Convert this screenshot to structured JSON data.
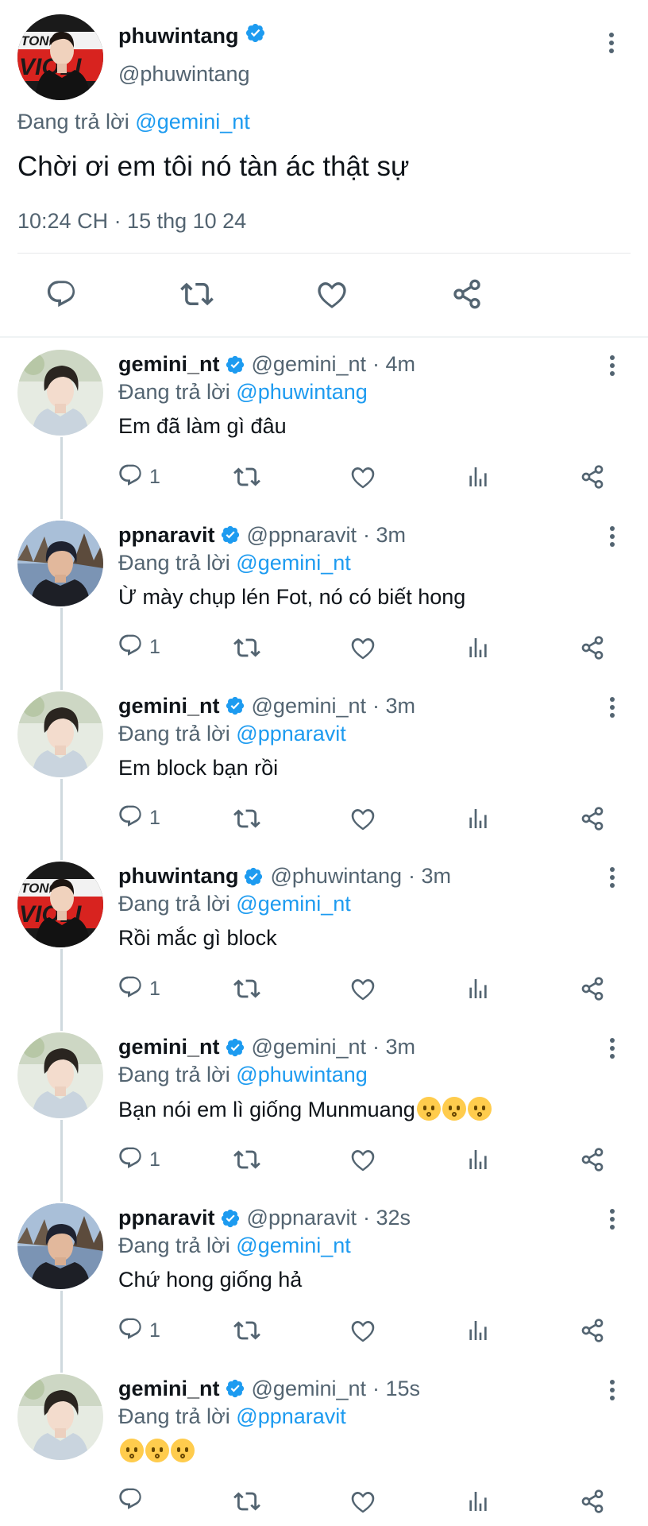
{
  "main_tweet": {
    "name": "phuwintang",
    "handle": "@phuwintang",
    "replying_prefix": "Đang trả lời",
    "replying_to": "@gemini_nt",
    "text": "Chời ơi em tôi nó tàn ác thật sự",
    "timestamp": "10:24 CH · 15 thg 10 24"
  },
  "replies": [
    {
      "name": "gemini_nt",
      "handle": "@gemini_nt",
      "time": "· 4m",
      "replying_prefix": "Đang trả lời",
      "replying_to": "@phuwintang",
      "text": "Em đã làm gì đâu",
      "reply_count": "1",
      "avatar": "gemini"
    },
    {
      "name": "ppnaravit",
      "handle": "@ppnaravit",
      "time": "· 3m",
      "replying_prefix": "Đang trả lời",
      "replying_to": "@gemini_nt",
      "text": "Ừ mày chụp lén Fot, nó có biết hong",
      "reply_count": "1",
      "avatar": "ppnaravit"
    },
    {
      "name": "gemini_nt",
      "handle": "@gemini_nt",
      "time": "· 3m",
      "replying_prefix": "Đang trả lời",
      "replying_to": "@ppnaravit",
      "text": "Em block bạn rồi",
      "reply_count": "1",
      "avatar": "gemini"
    },
    {
      "name": "phuwintang",
      "handle": "@phuwintang",
      "time": "· 3m",
      "replying_prefix": "Đang trả lời",
      "replying_to": "@gemini_nt",
      "text": "Rồi mắc gì block",
      "reply_count": "1",
      "avatar": "phuwin"
    },
    {
      "name": "gemini_nt",
      "handle": "@gemini_nt",
      "time": "· 3m",
      "replying_prefix": "Đang trả lời",
      "replying_to": "@phuwintang",
      "text": "Bạn nói em lì giống Munmuang",
      "text_emoji_count": 3,
      "reply_count": "1",
      "avatar": "gemini"
    },
    {
      "name": "ppnaravit",
      "handle": "@ppnaravit",
      "time": "· 32s",
      "replying_prefix": "Đang trả lời",
      "replying_to": "@gemini_nt",
      "text": "Chứ hong giống hả",
      "reply_count": "1",
      "avatar": "ppnaravit"
    },
    {
      "name": "gemini_nt",
      "handle": "@gemini_nt",
      "time": "· 15s",
      "replying_prefix": "Đang trả lời",
      "replying_to": "@ppnaravit",
      "text": "",
      "text_emoji_count": 3,
      "reply_count": "",
      "avatar": "gemini"
    }
  ],
  "avatar_art": {
    "phuwin": {
      "banner_text": "TONCR",
      "banner_text_2": "VIOLI"
    }
  },
  "colors": {
    "accent": "#1d9bf0",
    "secondary_text": "#536471",
    "verified": "#1d9bf0",
    "divider": "#e7e9ea"
  },
  "icons": [
    "reply-icon",
    "retweet-icon",
    "like-icon",
    "views-icon",
    "share-icon",
    "verified-icon",
    "more-icon"
  ]
}
